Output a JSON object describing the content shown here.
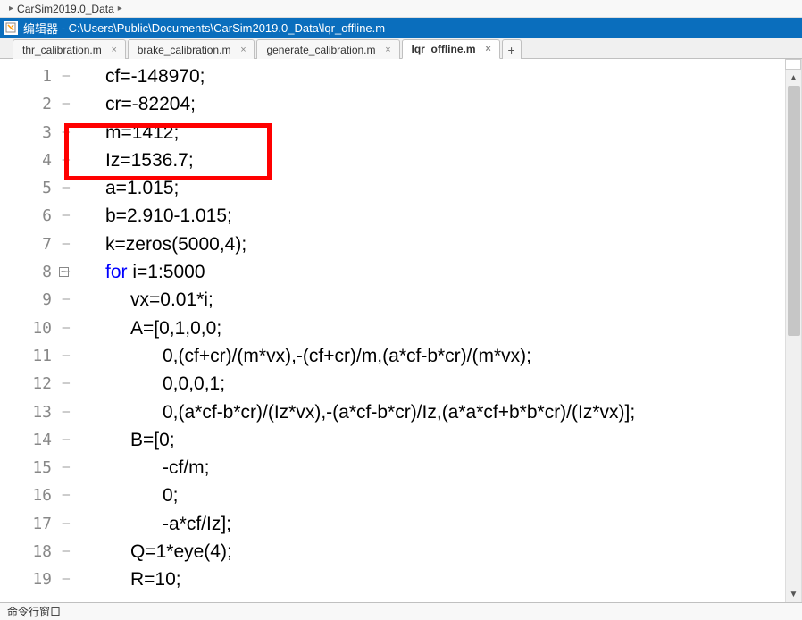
{
  "breadcrumb": {
    "item1": "CarSim2019.0_Data"
  },
  "titlebar": {
    "label": "编辑器",
    "path": "C:\\Users\\Public\\Documents\\CarSim2019.0_Data\\lqr_offline.m"
  },
  "tabs": [
    {
      "label": "thr_calibration.m",
      "active": false
    },
    {
      "label": "brake_calibration.m",
      "active": false
    },
    {
      "label": "generate_calibration.m",
      "active": false
    },
    {
      "label": "lqr_offline.m",
      "active": true
    }
  ],
  "code": {
    "lines": [
      {
        "n": 1,
        "indent": 0,
        "text": "cf=-148970;"
      },
      {
        "n": 2,
        "indent": 0,
        "text": "cr=-82204;"
      },
      {
        "n": 3,
        "indent": 0,
        "text": "m=1412;"
      },
      {
        "n": 4,
        "indent": 0,
        "text": "Iz=1536.7;"
      },
      {
        "n": 5,
        "indent": 0,
        "text": "a=1.015;"
      },
      {
        "n": 6,
        "indent": 0,
        "text": "b=2.910-1.015;"
      },
      {
        "n": 7,
        "indent": 0,
        "text": "k=zeros(5000,4);"
      },
      {
        "n": 8,
        "indent": 0,
        "kw": "for",
        "rest": " i=1:5000",
        "fold": true
      },
      {
        "n": 9,
        "indent": 1,
        "text": "vx=0.01*i;"
      },
      {
        "n": 10,
        "indent": 1,
        "text": "A=[0,1,0,0;"
      },
      {
        "n": 11,
        "indent": 2,
        "text": "0,(cf+cr)/(m*vx),-(cf+cr)/m,(a*cf-b*cr)/(m*vx);"
      },
      {
        "n": 12,
        "indent": 2,
        "text": "0,0,0,1;"
      },
      {
        "n": 13,
        "indent": 2,
        "text": "0,(a*cf-b*cr)/(Iz*vx),-(a*cf-b*cr)/Iz,(a*a*cf+b*b*cr)/(Iz*vx)];"
      },
      {
        "n": 14,
        "indent": 1,
        "text": "B=[0;"
      },
      {
        "n": 15,
        "indent": 2,
        "text": "-cf/m;"
      },
      {
        "n": 16,
        "indent": 2,
        "text": "0;"
      },
      {
        "n": 17,
        "indent": 2,
        "text": "-a*cf/Iz];"
      },
      {
        "n": 18,
        "indent": 1,
        "text": "Q=1*eye(4);"
      },
      {
        "n": 19,
        "indent": 1,
        "text": "R=10;"
      }
    ]
  },
  "statusbar": {
    "label": "命令行窗口"
  },
  "glyphs": {
    "close_x": "×",
    "plus": "+",
    "minus": "−",
    "sep_arrow": "▸",
    "up": "▲",
    "down": "▼"
  }
}
